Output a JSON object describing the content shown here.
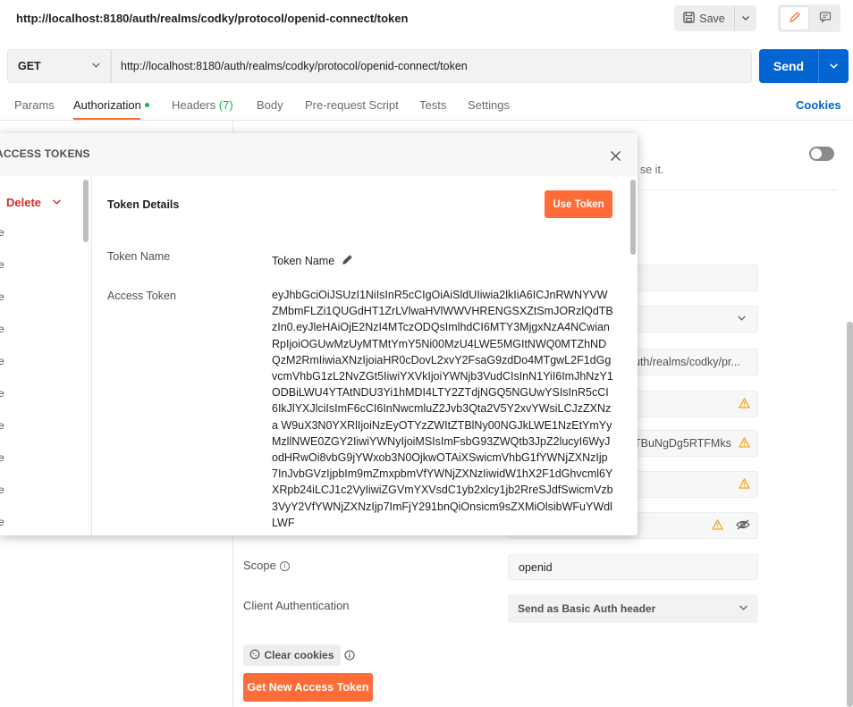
{
  "request": {
    "title": "http://localhost:8180/auth/realms/codky/protocol/openid-connect/token",
    "method": "GET",
    "url": "http://localhost:8180/auth/realms/codky/protocol/openid-connect/token"
  },
  "toolbar": {
    "save_label": "Save",
    "send_label": "Send"
  },
  "tabs": [
    {
      "label": "Params"
    },
    {
      "label": "Authorization"
    },
    {
      "label": "Headers",
      "count": "(7)"
    },
    {
      "label": "Body"
    },
    {
      "label": "Pre-request Script"
    },
    {
      "label": "Tests"
    },
    {
      "label": "Settings"
    }
  ],
  "cookies_label": "Cookies",
  "auth_panel": {
    "partial_text": "se it.",
    "callback_fragment": "uth/realms/codky/pr...",
    "client_id_fragment": "TBuNgDg5RTFMks",
    "scope_label": "Scope",
    "scope_value": "openid",
    "client_auth_label": "Client Authentication",
    "client_auth_value": "Send as Basic Auth header",
    "clear_cookies_label": "Clear cookies",
    "get_token_label": "Get New Access Token"
  },
  "modal": {
    "title": "ACCESS TOKENS",
    "delete_label": "Delete",
    "list_items": [
      "e",
      "e",
      "e",
      "e",
      "e",
      "e",
      "e",
      "e",
      "e",
      "e"
    ],
    "details_title": "Token Details",
    "use_token_label": "Use Token",
    "token_name_label": "Token Name",
    "token_name_value": "Token Name",
    "access_token_label": "Access Token",
    "access_token_value": "eyJhbGciOiJSUzI1NiIsInR5cCIgOiAiSldUIiwia2lkIiA6ICJnRWNYVWZMbmFLZi1QUGdHT1ZrLVlwaHVlWWVHRENGSXZtSmJORzlQdTBzIn0.eyJleHAiOjE2NzI4MTczODQsImlhdCI6MTY3MjgxNzA4NCwianRpIjoiOGUwMzUyMTMtYmY5Ni00MzU4LWE5MGItNWQ0MTZhNDQzM2RmIiwiaXNzIjoiaHR0cDovL2xvY2FsaG9zdDo4MTgwL2F1dGgvcmVhbG1zL2NvZGt5IiwiYXVkIjoiYWNjb3VudCIsInN1YiI6ImJhNzY1ODBiLWU4YTAtNDU3Yi1hMDI4LTY2ZTdjNGQ5NGUwYSIsInR5cCI6IkJlYXJlciIsImF6cCI6InNwcmluZ2Jvb3Qta2V5Y2xvYWsiLCJzZXNza W9uX3N0YXRlIjoiNzEyOTYzZWItZTBlNy00NGJkLWE1NzEtYmYyMzllNWE0ZGY2IiwiYWNyIjoiMSIsImFsbG93ZWQtb3JpZ2lucyI6WyJodHRwOi8vbG9jYWxob3N0OjkwOTAiXSwicmVhbG1fYWNjZXNzIjp7InJvbGVzIjpbIm9mZmxpbmVfYWNjZXNzIiwidW1hX2F1dGhvcml6YXRpb24iLCJ1c2VyIiwiZGVmYXVsdC1yb2xlcy1jb2RreSJdfSwicmVzb3VyY2VfYWNjZXNzIjp7ImFjY291bnQiOnsicm9sZXMiOlsibWFuYWdlLWF"
  },
  "colors": {
    "accent": "#ff6c37",
    "primary": "#0265d2",
    "danger": "#d12e2e",
    "success": "#0cbb52",
    "warning": "#f5a623"
  },
  "icons": {
    "save": "floppy-disk-icon",
    "edit": "pencil-icon",
    "docs": "comment-icon",
    "close": "close-icon",
    "eye": "eye-slash-icon",
    "warning": "warning-icon",
    "info": "info-icon",
    "cookie": "cookie-icon"
  }
}
